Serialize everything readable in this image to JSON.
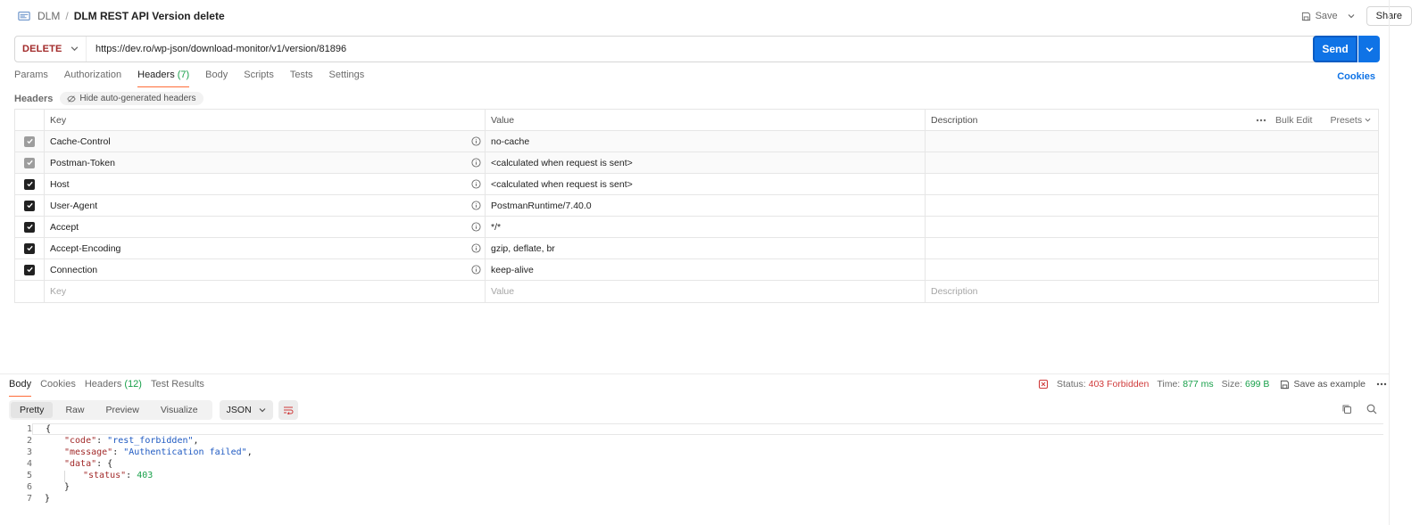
{
  "topbar": {
    "breadcrumb_parent": "DLM",
    "breadcrumb_sep": "/",
    "breadcrumb_current": "DLM REST API Version delete",
    "save_label": "Save",
    "share_label": "Share"
  },
  "request": {
    "method": "DELETE",
    "url": "https://dev.ro/wp-json/download-monitor/v1/version/81896",
    "send_label": "Send"
  },
  "tabs": [
    {
      "label": "Params",
      "count": ""
    },
    {
      "label": "Authorization",
      "count": ""
    },
    {
      "label": "Headers",
      "count": "(7)"
    },
    {
      "label": "Body",
      "count": ""
    },
    {
      "label": "Scripts",
      "count": ""
    },
    {
      "label": "Tests",
      "count": ""
    },
    {
      "label": "Settings",
      "count": ""
    }
  ],
  "cookies_label": "Cookies",
  "headers_section": {
    "label": "Headers",
    "hide_auto_label": "Hide auto-generated headers"
  },
  "table": {
    "columns": {
      "key": "Key",
      "value": "Value",
      "description": "Description"
    },
    "bulk_edit": "Bulk Edit",
    "presets": "Presets",
    "rows": [
      {
        "key": "Cache-Control",
        "value": "no-cache",
        "checked": true,
        "auto": true
      },
      {
        "key": "Postman-Token",
        "value": "<calculated when request is sent>",
        "checked": true,
        "auto": true
      },
      {
        "key": "Host",
        "value": "<calculated when request is sent>",
        "checked": true,
        "auto": false
      },
      {
        "key": "User-Agent",
        "value": "PostmanRuntime/7.40.0",
        "checked": true,
        "auto": false
      },
      {
        "key": "Accept",
        "value": "*/*",
        "checked": true,
        "auto": false
      },
      {
        "key": "Accept-Encoding",
        "value": "gzip, deflate, br",
        "checked": true,
        "auto": false
      },
      {
        "key": "Connection",
        "value": "keep-alive",
        "checked": true,
        "auto": false
      }
    ],
    "placeholder": {
      "key": "Key",
      "value": "Value",
      "description": "Description"
    }
  },
  "response": {
    "tabs": [
      {
        "label": "Body",
        "count": ""
      },
      {
        "label": "Cookies",
        "count": ""
      },
      {
        "label": "Headers",
        "count": "(12)"
      },
      {
        "label": "Test Results",
        "count": ""
      }
    ],
    "status_label": "Status:",
    "status_value": "403 Forbidden",
    "time_label": "Time:",
    "time_value": "877 ms",
    "size_label": "Size:",
    "size_value": "699 B",
    "save_example": "Save as example",
    "view_modes": [
      "Pretty",
      "Raw",
      "Preview",
      "Visualize"
    ],
    "format": "JSON",
    "body_lines": [
      "{",
      "\"code\": \"rest_forbidden\",",
      "\"message\": \"Authentication failed\",",
      "\"data\": {",
      "\"status\": 403",
      "}",
      "}"
    ],
    "line_numbers": [
      "1",
      "2",
      "3",
      "4",
      "5",
      "6",
      "7"
    ]
  }
}
